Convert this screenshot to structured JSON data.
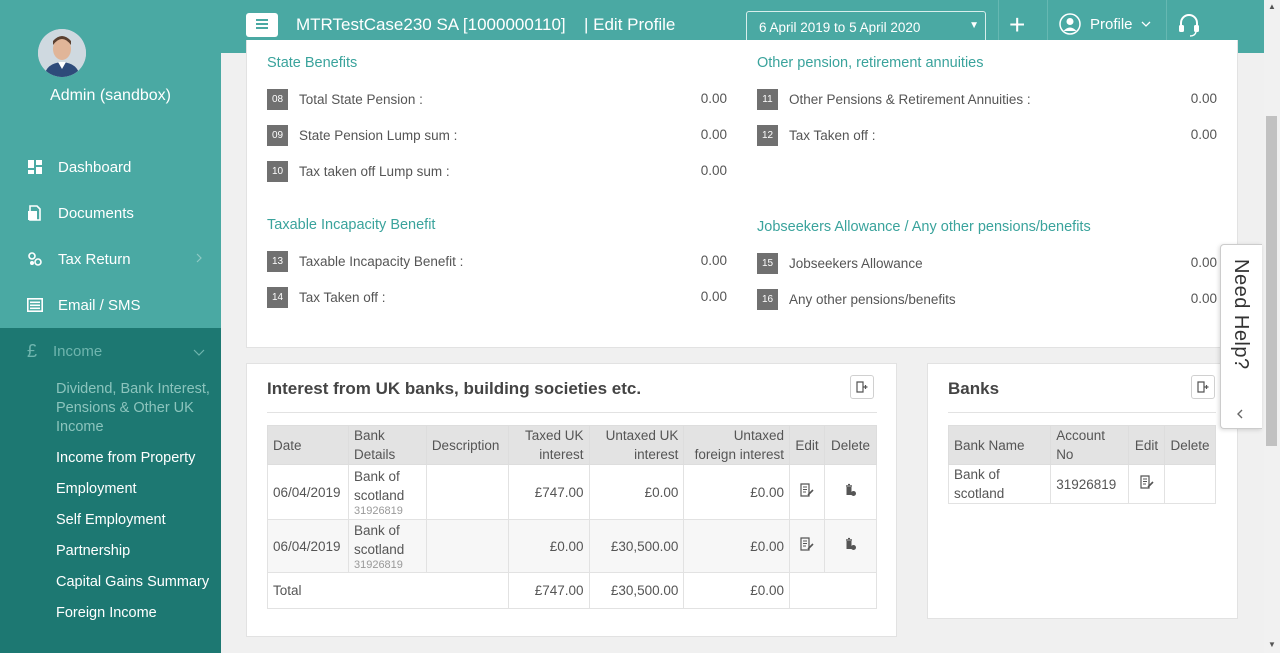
{
  "sidebar": {
    "admin_name": "Admin (sandbox)",
    "nav": [
      {
        "label": "Dashboard",
        "icon": "dashboard-icon"
      },
      {
        "label": "Documents",
        "icon": "documents-icon"
      },
      {
        "label": "Tax Return",
        "icon": "tax-return-icon"
      },
      {
        "label": "Email / SMS",
        "icon": "email-icon"
      }
    ],
    "income": {
      "label": "Income",
      "symbol": "£"
    },
    "sub_items": [
      "Dividend, Bank Interest, Pensions & Other UK Income",
      "Income from Property",
      "Employment",
      "Self Employment",
      "Partnership",
      "Capital Gains Summary",
      "Foreign Income"
    ]
  },
  "topbar": {
    "title": "MTRTestCase230 SA [1000000110]",
    "edit_profile": "| Edit Profile",
    "date_range": "6 April 2019 to 5 April 2020",
    "plus": "+",
    "profile_label": "Profile"
  },
  "state_benefits": {
    "title": "State Benefits",
    "rows": [
      {
        "no": "08",
        "label": "Total State Pension :",
        "value": "0.00"
      },
      {
        "no": "09",
        "label": "State Pension Lump sum :",
        "value": "0.00"
      },
      {
        "no": "10",
        "label": "Tax taken off Lump sum :",
        "value": "0.00"
      }
    ]
  },
  "other_pension": {
    "title": "Other pension, retirement annuities",
    "rows": [
      {
        "no": "11",
        "label": "Other Pensions & Retirement Annuities :",
        "value": "0.00"
      },
      {
        "no": "12",
        "label": "Tax Taken off :",
        "value": "0.00"
      }
    ]
  },
  "incapacity": {
    "title": "Taxable Incapacity Benefit",
    "rows": [
      {
        "no": "13",
        "label": "Taxable Incapacity Benefit :",
        "value": "0.00"
      },
      {
        "no": "14",
        "label": "Tax Taken off :",
        "value": "0.00"
      }
    ]
  },
  "jobseekers": {
    "title": "Jobseekers Allowance / Any other pensions/benefits",
    "rows": [
      {
        "no": "15",
        "label": "Jobseekers Allowance",
        "value": "0.00"
      },
      {
        "no": "16",
        "label": "Any other pensions/benefits",
        "value": "0.00"
      }
    ]
  },
  "interest": {
    "title": "Interest from UK banks, building societies etc.",
    "headers": [
      "Date",
      "Bank Details",
      "Description",
      "Taxed UK interest",
      "Untaxed UK interest",
      "Untaxed foreign interest",
      "Edit",
      "Delete"
    ],
    "rows": [
      {
        "date": "06/04/2019",
        "bank": "Bank of scotland",
        "account": "31926819",
        "description": "",
        "taxed": "£747.00",
        "untaxed": "£0.00",
        "foreign": "£0.00"
      },
      {
        "date": "06/04/2019",
        "bank": "Bank of scotland",
        "account": "31926819",
        "description": "",
        "taxed": "£0.00",
        "untaxed": "£30,500.00",
        "foreign": "£0.00"
      }
    ],
    "total": {
      "label": "Total",
      "taxed": "£747.00",
      "untaxed": "£30,500.00",
      "foreign": "£0.00"
    }
  },
  "banks": {
    "title": "Banks",
    "headers": [
      "Bank Name",
      "Account No",
      "Edit",
      "Delete"
    ],
    "rows": [
      {
        "name": "Bank of scotland",
        "account": "31926819"
      }
    ]
  },
  "need_help": "Need Help?"
}
